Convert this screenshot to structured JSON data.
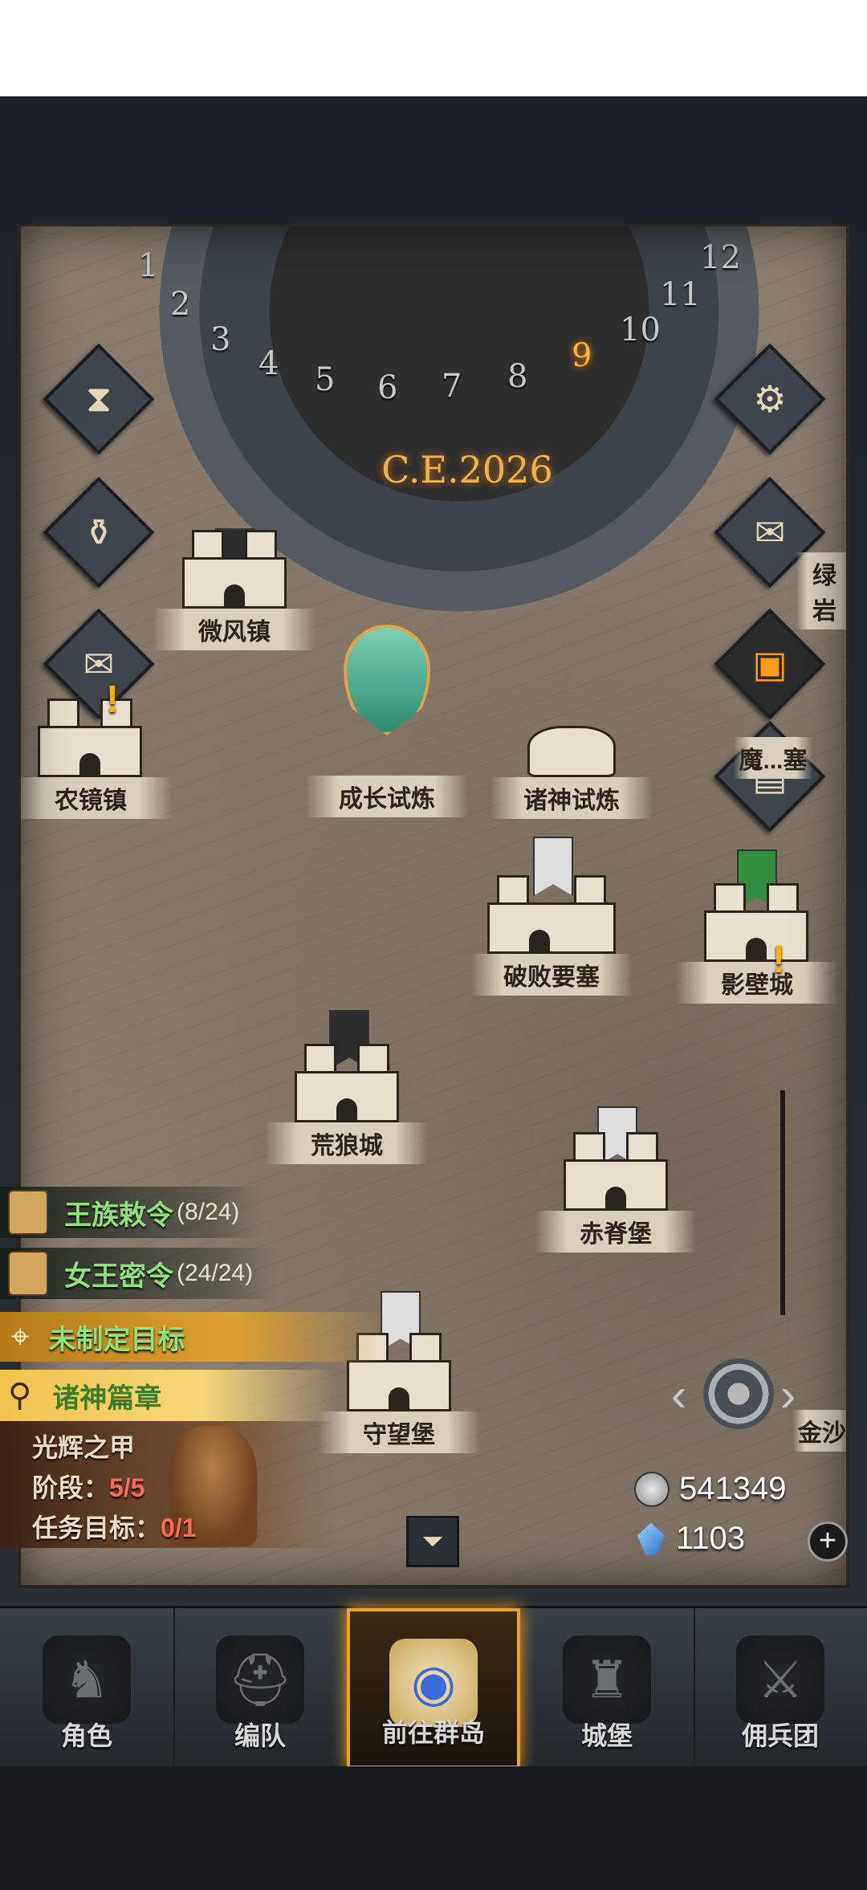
{
  "calendar": {
    "year": "C.E.2026",
    "months": [
      "1",
      "2",
      "3",
      "4",
      "5",
      "6",
      "7",
      "8",
      "9",
      "10",
      "11",
      "12"
    ],
    "current_month": "9"
  },
  "side_buttons": {
    "left": [
      "hourglass-icon",
      "money-bag-icon",
      "scroll-icon"
    ],
    "right": [
      "gear-icon",
      "mail-icon",
      "shop-icon",
      "crate-icon"
    ]
  },
  "locations": {
    "weifeng": "微风镇",
    "nongjing": "农镜镇",
    "growth_trial": "成长试炼",
    "gods_trial": "诸神试炼",
    "ruined_fortress": "破败要塞",
    "yingbi_city": "影壁城",
    "huanglang_city": "荒狼城",
    "chiji_fort": "赤脊堡",
    "shouwang_fort": "守望堡",
    "lv_partial": "绿岩",
    "mo_partial": "魔...塞",
    "jinsha_partial": "金沙"
  },
  "quests": [
    {
      "title": "王族敕令",
      "count": "(8/24)"
    },
    {
      "title": "女王密令",
      "count": "(24/24)"
    }
  ],
  "goal": {
    "label": "未制定目标"
  },
  "chapter": {
    "label": "诸神篇章"
  },
  "story": {
    "name": "光辉之甲",
    "stage_label": "阶段：",
    "stage_value": "5/5",
    "task_label": "任务目标：",
    "task_value": "0/1"
  },
  "resources": {
    "silver": "541349",
    "gems": "1103",
    "add_symbol": "+"
  },
  "nav": [
    {
      "label": "角色",
      "icon": "knight-icon"
    },
    {
      "label": "编队",
      "icon": "helmet-icon"
    },
    {
      "label": "前往群岛",
      "icon": "globe-icon"
    },
    {
      "label": "城堡",
      "icon": "castle-icon"
    },
    {
      "label": "佣兵团",
      "icon": "mercenary-icon"
    }
  ],
  "colors": {
    "accent": "#f0a21e",
    "quest_green": "#8fe27a",
    "stage_red": "#ff6a55",
    "map_parchment": "#8a7e70"
  }
}
